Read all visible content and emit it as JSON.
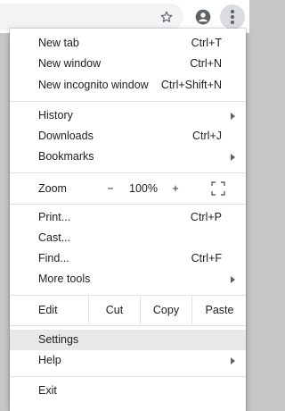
{
  "toolbar": {
    "bookmark_icon": "star-icon",
    "profile_icon": "account-circle-icon",
    "menu_icon": "three-dot-menu-icon"
  },
  "menu": {
    "new_tab": {
      "label": "New tab",
      "shortcut": "Ctrl+T"
    },
    "new_window": {
      "label": "New window",
      "shortcut": "Ctrl+N"
    },
    "new_incognito": {
      "label": "New incognito window",
      "shortcut": "Ctrl+Shift+N"
    },
    "history": {
      "label": "History"
    },
    "downloads": {
      "label": "Downloads",
      "shortcut": "Ctrl+J"
    },
    "bookmarks": {
      "label": "Bookmarks"
    },
    "zoom": {
      "label": "Zoom",
      "minus": "−",
      "value": "100%",
      "plus": "+",
      "fullscreen_icon": "fullscreen-icon"
    },
    "print": {
      "label": "Print...",
      "shortcut": "Ctrl+P"
    },
    "cast": {
      "label": "Cast..."
    },
    "find": {
      "label": "Find...",
      "shortcut": "Ctrl+F"
    },
    "more_tools": {
      "label": "More tools"
    },
    "edit": {
      "label": "Edit",
      "cut": "Cut",
      "copy": "Copy",
      "paste": "Paste"
    },
    "settings": {
      "label": "Settings"
    },
    "help": {
      "label": "Help"
    },
    "exit": {
      "label": "Exit"
    }
  },
  "colors": {
    "background": "#c7c7c7",
    "menu_bg": "#ffffff",
    "highlight": "#e8e8e8",
    "separator": "#e0e0e0",
    "icon": "#5f6368"
  }
}
